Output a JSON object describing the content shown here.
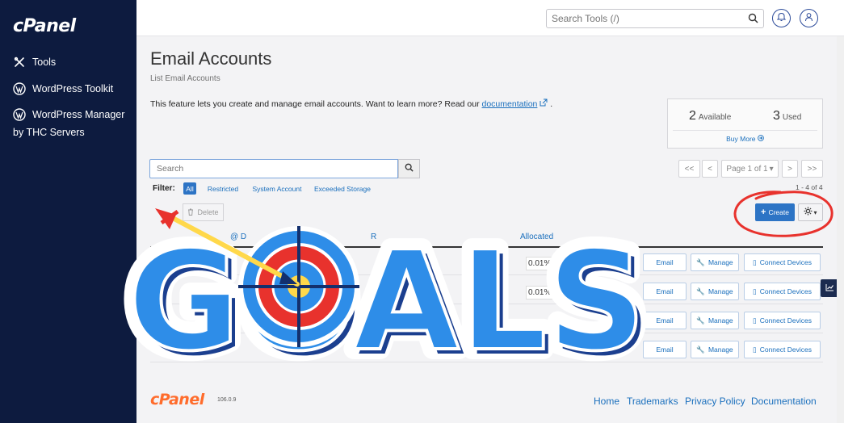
{
  "sidebar": {
    "logo": "cPanel",
    "items": [
      {
        "label": "Tools",
        "icon": "tools-icon"
      },
      {
        "label": "WordPress Toolkit",
        "icon": "wordpress-icon"
      },
      {
        "label": "WordPress Manager",
        "icon": "wordpress-icon"
      }
    ],
    "sub_label": "by THC Servers"
  },
  "header": {
    "search_placeholder": "Search Tools (/)"
  },
  "main": {
    "title": "Email Accounts",
    "subtitle": "List Email Accounts",
    "description": "This feature lets you create and manage email accounts. Want to learn more? Read our",
    "doc_link": "documentation",
    "desc_end": ".",
    "stats": {
      "available_value": "2",
      "available_label": "Available",
      "used_value": "3",
      "used_label": "Used",
      "buy_more": "Buy More"
    },
    "search_placeholder": "Search",
    "pagination": {
      "first": "<<",
      "prev": "<",
      "page": "Page 1 of 1",
      "next": ">",
      "last": ">>"
    },
    "range": "1 - 4 of 4",
    "filter": {
      "label": "Filter:",
      "options": [
        "All",
        "Restricted",
        "System Account",
        "Exceeded Storage"
      ],
      "active": "All"
    },
    "delete_label": "Delete",
    "create_label": "Create",
    "table": {
      "headers": {
        "account": "@ D",
        "restrictions": "R",
        "allocated": "Allocated"
      },
      "rows": [
        {
          "usage": "0.01%",
          "email": "Email",
          "manage": "Manage",
          "devices": "Connect Devices"
        },
        {
          "usage": "0.01%",
          "email": "Email",
          "manage": "Manage",
          "devices": "Connect Devices"
        },
        {
          "usage": "",
          "email": "Email",
          "manage": "Manage",
          "devices": "Connect Devices"
        },
        {
          "usage": "",
          "email": "Email",
          "manage": "Manage",
          "devices": "Connect Devices"
        }
      ]
    }
  },
  "footer": {
    "logo": "cPanel",
    "version": "106.0.9",
    "links": [
      "Home",
      "Trademarks",
      "Privacy Policy",
      "Documentation"
    ]
  },
  "overlay": {
    "text": "GOALS"
  },
  "colors": {
    "sidebar_bg": "#0d1b3f",
    "accent": "#2d74c5",
    "brand_orange": "#ff6c2c",
    "overlay_blue": "#2e8de8",
    "annotation_red": "#e8322d"
  }
}
